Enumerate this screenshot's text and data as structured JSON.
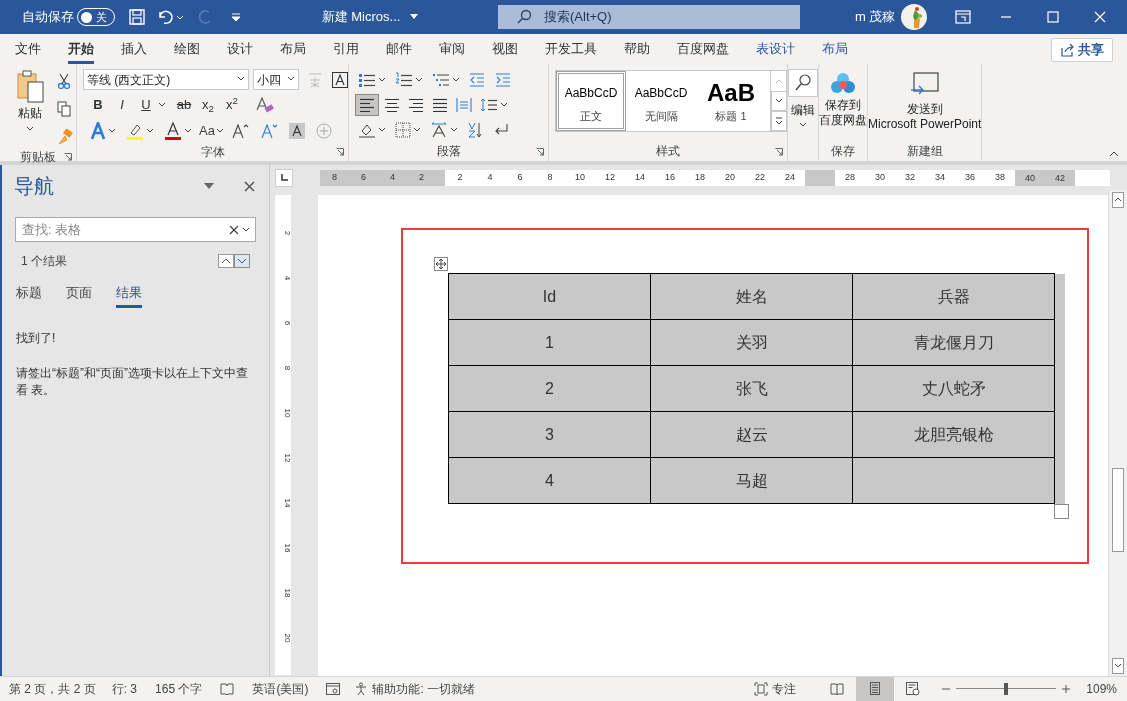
{
  "title_bar": {
    "autosave_label": "自动保存",
    "autosave": {
      "label": "关",
      "on": false
    },
    "document_title": "新建 Micros...",
    "search": {
      "placeholder": "搜索(Alt+Q)"
    },
    "user": "m 茂稼"
  },
  "ribbon_tabs": [
    {
      "label": "文件",
      "selected": false,
      "contextual": false
    },
    {
      "label": "开始",
      "selected": true,
      "contextual": false
    },
    {
      "label": "插入",
      "selected": false,
      "contextual": false
    },
    {
      "label": "绘图",
      "selected": false,
      "contextual": false
    },
    {
      "label": "设计",
      "selected": false,
      "contextual": false
    },
    {
      "label": "布局",
      "selected": false,
      "contextual": false
    },
    {
      "label": "引用",
      "selected": false,
      "contextual": false
    },
    {
      "label": "邮件",
      "selected": false,
      "contextual": false
    },
    {
      "label": "审阅",
      "selected": false,
      "contextual": false
    },
    {
      "label": "视图",
      "selected": false,
      "contextual": false
    },
    {
      "label": "开发工具",
      "selected": false,
      "contextual": false
    },
    {
      "label": "帮助",
      "selected": false,
      "contextual": false
    },
    {
      "label": "百度网盘",
      "selected": false,
      "contextual": false
    },
    {
      "label": "表设计",
      "selected": false,
      "contextual": true
    },
    {
      "label": "布局",
      "selected": false,
      "contextual": true
    }
  ],
  "share_button": "共享",
  "ribbon": {
    "clipboard": {
      "paste": "粘贴",
      "label": "剪贴板"
    },
    "font": {
      "font_name": "等线 (西文正文)",
      "font_size": "小四",
      "format_buttons": [
        "B",
        "I",
        "U",
        "ab",
        "x$_{2}$",
        "x$^{2}$"
      ],
      "change_case": "Aa",
      "label": "字体"
    },
    "paragraph": {
      "label": "段落"
    },
    "styles": {
      "items": [
        {
          "sample": "AaBbCcD",
          "name": "正文",
          "selected": true
        },
        {
          "sample": "AaBbCcD",
          "name": "无间隔",
          "selected": false
        },
        {
          "sample": "AaB",
          "name": "标题 1",
          "selected": false
        }
      ],
      "label": "样式"
    },
    "editing": {
      "label": "编辑"
    },
    "save": {
      "button_lines": [
        "保存到",
        "百度网盘"
      ],
      "label": "保存"
    },
    "new_group": {
      "button_lines": [
        "发送到",
        "Microsoft PowerPoint"
      ],
      "label": "新建组"
    }
  },
  "navigation": {
    "title": "导航",
    "search": {
      "placeholder": "查找: 表格"
    },
    "result_count": "1 个结果",
    "tabs": [
      {
        "label": "标题",
        "selected": false
      },
      {
        "label": "页面",
        "selected": false
      },
      {
        "label": "结果",
        "selected": true
      }
    ],
    "messages": [
      "找到了!",
      "请签出“标题”和“页面”选项卡以在上下文中查看 表。"
    ]
  },
  "ruler": {
    "left_numbers": [
      "8",
      "6",
      "4",
      "2"
    ],
    "numbers": [
      "2",
      "4",
      "6",
      "8",
      "10",
      "12",
      "14",
      "16",
      "18",
      "20",
      "22",
      "24",
      "28",
      "30",
      "32",
      "34",
      "36",
      "38",
      "40",
      "42"
    ],
    "vertical_numbers": [
      "2",
      "4",
      "6",
      "8",
      "10",
      "12",
      "14",
      "16",
      "18",
      "20"
    ]
  },
  "table": {
    "columns": [
      "Id",
      "姓名",
      "兵器"
    ],
    "rows": [
      [
        "1",
        "关羽",
        "青龙偃月刀"
      ],
      [
        "2",
        "张飞",
        "丈八蛇矛"
      ],
      [
        "3",
        "赵云",
        "龙胆亮银枪"
      ],
      [
        "4",
        "马超",
        ""
      ]
    ]
  },
  "status_bar": {
    "page": "第 2 页，共 2 页",
    "line": "行: 3",
    "words": "165 个字",
    "language": "英语(美国)",
    "accessibility": "辅助功能: 一切就绪",
    "focus": "专注",
    "views": [
      {
        "kind": "read",
        "selected": false
      },
      {
        "kind": "print",
        "selected": true
      },
      {
        "kind": "web",
        "selected": false
      }
    ],
    "zoom": {
      "level": 0.5,
      "reading": "109%"
    }
  }
}
